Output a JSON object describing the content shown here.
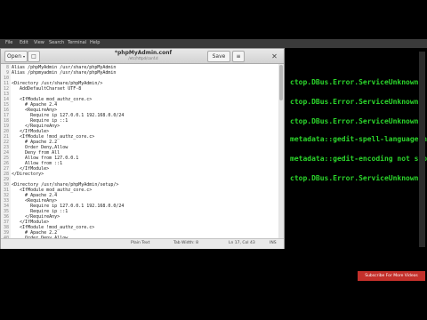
{
  "terminal": {
    "menu": [
      "File",
      "Edit",
      "View",
      "Search",
      "Terminal",
      "Help"
    ],
    "lines": [
      "ctop.DBus.Error.ServiceUnknown: The n",
      "ctop.DBus.Error.ServiceUnknown: The n",
      "ctop.DBus.Error.ServiceUnknown: The n",
      "metadata::gedit-spell-language not su",
      "metadata::gedit-encoding not supporte",
      "ctop.DBus.Error.ServiceUnknown: The n"
    ]
  },
  "gedit": {
    "open_label": "Open",
    "save_label": "Save",
    "title": "*phpMyAdmin.conf",
    "subtitle": "/etc/httpd/conf.d",
    "code_lines": [
      {
        "n": "8",
        "t": "Alias /phpMyAdmin /usr/share/phpMyAdmin"
      },
      {
        "n": "9",
        "t": "Alias /phpmyadmin /usr/share/phpMyAdmin"
      },
      {
        "n": "10",
        "t": ""
      },
      {
        "n": "11",
        "t": "<Directory /usr/share/phpMyAdmin/>"
      },
      {
        "n": "12",
        "t": "   AddDefaultCharset UTF-8"
      },
      {
        "n": "13",
        "t": ""
      },
      {
        "n": "14",
        "t": "   <IfModule mod_authz_core.c>"
      },
      {
        "n": "15",
        "t": "     # Apache 2.4"
      },
      {
        "n": "16",
        "t": "     <RequireAny>"
      },
      {
        "n": "17",
        "t": "       Require ip 127.0.0.1 192.168.0.0/24"
      },
      {
        "n": "18",
        "t": "       Require ip ::1"
      },
      {
        "n": "19",
        "t": "     </RequireAny>"
      },
      {
        "n": "20",
        "t": "   </IfModule>"
      },
      {
        "n": "21",
        "t": "   <IfModule !mod_authz_core.c>"
      },
      {
        "n": "22",
        "t": "     # Apache 2.2"
      },
      {
        "n": "23",
        "t": "     Order Deny,Allow"
      },
      {
        "n": "24",
        "t": "     Deny from All"
      },
      {
        "n": "25",
        "t": "     Allow from 127.0.0.1"
      },
      {
        "n": "26",
        "t": "     Allow from ::1"
      },
      {
        "n": "27",
        "t": "   </IfModule>"
      },
      {
        "n": "28",
        "t": "</Directory>"
      },
      {
        "n": "29",
        "t": ""
      },
      {
        "n": "30",
        "t": "<Directory /usr/share/phpMyAdmin/setup/>"
      },
      {
        "n": "31",
        "t": "   <IfModule mod_authz_core.c>"
      },
      {
        "n": "32",
        "t": "     # Apache 2.4"
      },
      {
        "n": "33",
        "t": "     <RequireAny>"
      },
      {
        "n": "34",
        "t": "       Require ip 127.0.0.1 192.168.0.0/24"
      },
      {
        "n": "35",
        "t": "       Require ip ::1"
      },
      {
        "n": "36",
        "t": "     </RequireAny>"
      },
      {
        "n": "37",
        "t": "   </IfModule>"
      },
      {
        "n": "38",
        "t": "   <IfModule !mod_authz_core.c>"
      },
      {
        "n": "39",
        "t": "     # Apache 2.2"
      },
      {
        "n": "40",
        "t": "     Order Deny,Allow"
      }
    ],
    "status": {
      "language": "Plain Text",
      "tab_width": "Tab Width: 8",
      "position": "Ln 17, Col 43",
      "mode": "INS"
    }
  },
  "overlay": {
    "subscribe": "Subscribe For More Videos"
  }
}
